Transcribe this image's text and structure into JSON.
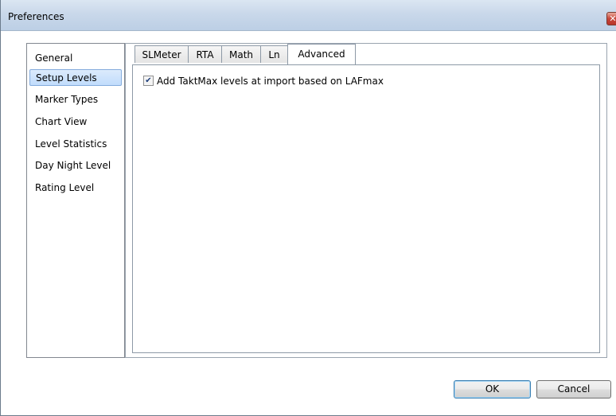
{
  "window": {
    "title": "Preferences",
    "close_glyph": "✕"
  },
  "sidebar": {
    "items": [
      {
        "label": "General"
      },
      {
        "label": "Setup Levels",
        "selected": true
      },
      {
        "label": "Marker Types"
      },
      {
        "label": "Chart View"
      },
      {
        "label": "Level Statistics"
      },
      {
        "label": "Day Night Level"
      },
      {
        "label": "Rating Level"
      }
    ]
  },
  "tabs": {
    "items": [
      {
        "label": "SLMeter"
      },
      {
        "label": "RTA"
      },
      {
        "label": "Math"
      },
      {
        "label": "Ln"
      },
      {
        "label": "Advanced",
        "active": true
      }
    ]
  },
  "advanced": {
    "checkbox_label": "Add TaktMax levels at import based on LAFmax",
    "checkbox_checked": true,
    "check_glyph": "✔"
  },
  "footer": {
    "ok_label": "OK",
    "cancel_label": "Cancel"
  }
}
